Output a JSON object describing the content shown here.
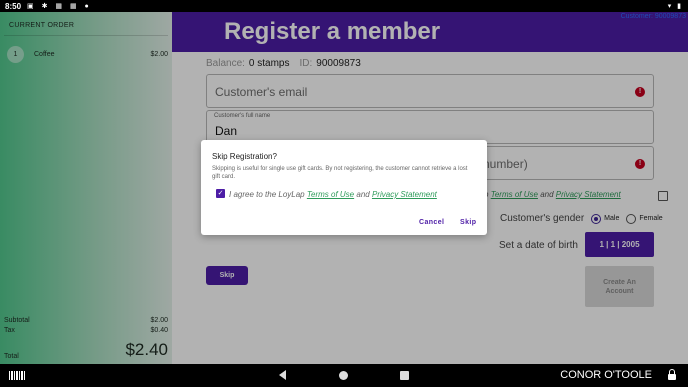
{
  "status_bar": {
    "time": "8:50",
    "icons": "▣ ✱ ▦ ▦ ●",
    "right_icons": "▾ ▮"
  },
  "order": {
    "header": "CURRENT ORDER",
    "items": [
      {
        "qty": "1",
        "name": "Coffee",
        "price": "$2.00"
      }
    ],
    "subtotal_label": "Subtotal",
    "subtotal": "$2.00",
    "tax_label": "Tax",
    "tax": "$0.40",
    "total_label": "Total",
    "total": "$2.40"
  },
  "header": {
    "title": "Register a member",
    "customer_link": "Customer: 90009873"
  },
  "form": {
    "balance_label": "Balance:",
    "balance_value": "0 stamps",
    "id_label": "ID:",
    "id_value": "90009873",
    "email_placeholder": "Customer's email",
    "name_label": "Customer's full name",
    "name_value": "Dan",
    "phone_placeholder_visible": "number)",
    "consent_prefix": "p",
    "consent_terms": "Terms of Use",
    "consent_and": "and",
    "consent_privacy": "Privacy Statement",
    "gender_label": "Customer's gender",
    "gender_male": "Male",
    "gender_female": "Female",
    "dob_label": "Set a date of birth",
    "dob_value": "1 | 1 | 2005",
    "skip_label": "Skip",
    "create_label": "Create An Account"
  },
  "dialog": {
    "title": "Skip Registration?",
    "message": "Skipping is useful for single use gift cards. By not registering, the customer cannot retrieve a lost gift card.",
    "consent_prefix": "I agree to the LoyLap",
    "consent_terms": "Terms of Use",
    "consent_and": "and",
    "consent_privacy": "Privacy Statement",
    "cancel_label": "Cancel",
    "skip_label": "Skip"
  },
  "nav_bar": {
    "user_name": "CONOR O'TOOLE"
  },
  "colors": {
    "brand_purple": "#4d1da6",
    "link_green": "#2e9b5a",
    "error_red": "#c6001f"
  }
}
